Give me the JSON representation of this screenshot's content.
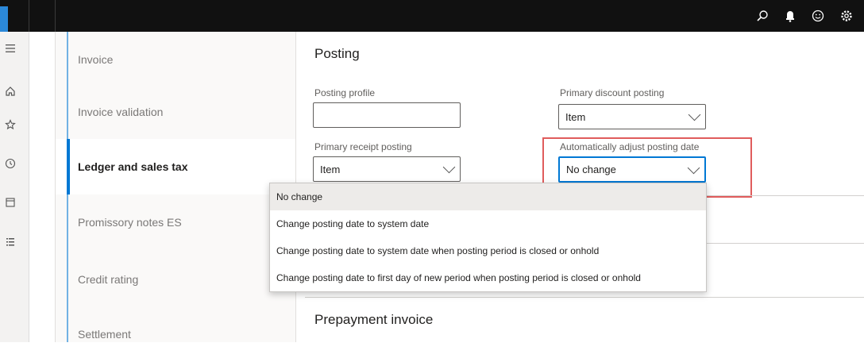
{
  "sidebar": {
    "tabs": [
      {
        "label": "Invoice",
        "active": false
      },
      {
        "label": "Invoice validation",
        "active": false
      },
      {
        "label": "Ledger and sales tax",
        "active": true
      },
      {
        "label": "Promissory notes ES",
        "active": false
      },
      {
        "label": "Credit rating",
        "active": false
      },
      {
        "label": "Settlement",
        "active": false
      }
    ]
  },
  "posting": {
    "title": "Posting",
    "posting_profile": {
      "label": "Posting profile",
      "value": ""
    },
    "primary_discount_posting": {
      "label": "Primary discount posting",
      "value": "Item"
    },
    "primary_receipt_posting": {
      "label": "Primary receipt posting",
      "value": "Item"
    },
    "auto_adjust_posting_date": {
      "label": "Automatically adjust posting date",
      "value": "No change"
    }
  },
  "dropdown": {
    "options": [
      "No change",
      "Change posting date to system date",
      "Change posting date to system date when posting period is closed or onhold",
      "Change posting date to first day of new period when posting period is closed or onhold"
    ],
    "selected_index": 0
  },
  "prepayment": {
    "title": "Prepayment invoice"
  },
  "topbar": {
    "icons": [
      "search-icon",
      "notifications-icon",
      "feedback-smiley-icon",
      "settings-icon"
    ]
  },
  "colors": {
    "accent": "#0078d4",
    "highlight_border": "#e05c5c",
    "topbar": "#111111"
  }
}
